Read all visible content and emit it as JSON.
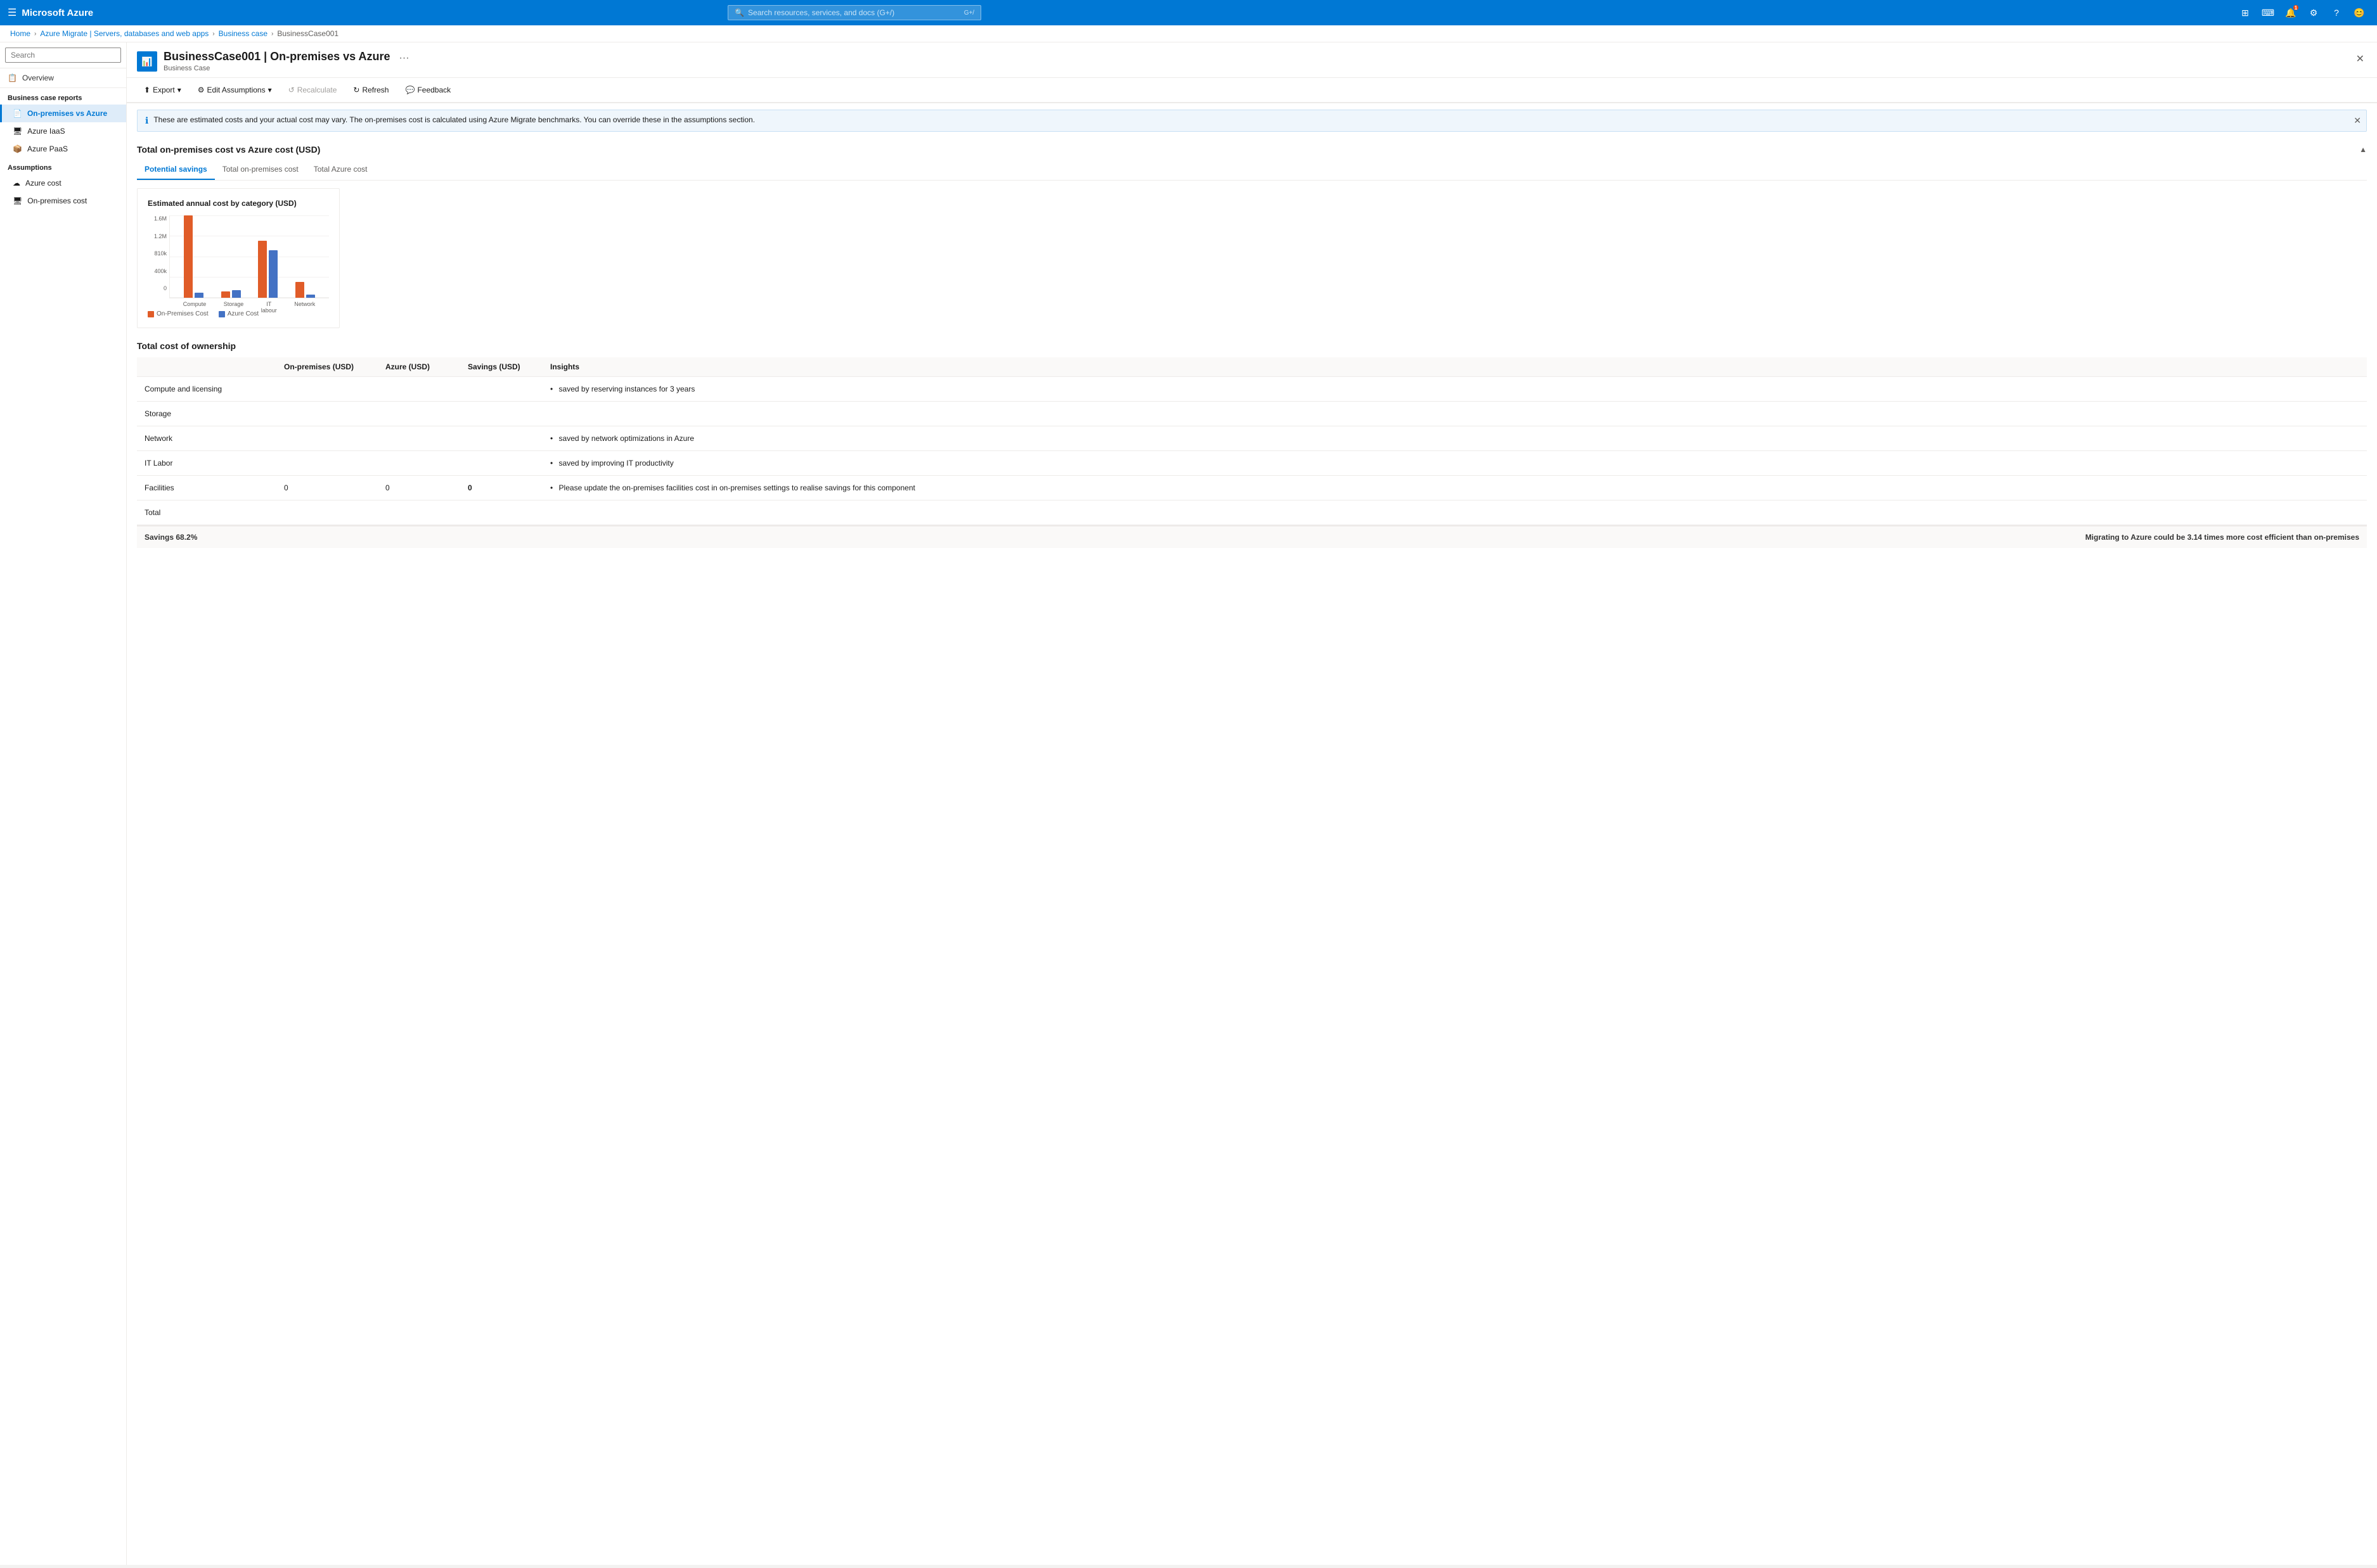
{
  "topnav": {
    "logo": "Microsoft Azure",
    "search_placeholder": "Search resources, services, and docs (G+/)",
    "hamburger": "☰"
  },
  "breadcrumb": {
    "items": [
      "Home",
      "Azure Migrate | Servers, databases and web apps",
      "Business case",
      "BusinessCase001"
    ]
  },
  "page": {
    "title": "BusinessCase001 | On-premises vs Azure",
    "subtitle": "Business Case",
    "icon": "📊"
  },
  "toolbar": {
    "export_label": "Export",
    "edit_assumptions_label": "Edit Assumptions",
    "recalculate_label": "Recalculate",
    "refresh_label": "Refresh",
    "feedback_label": "Feedback"
  },
  "info_banner": {
    "text": "These are estimated costs and your actual cost may vary. The on-premises cost is calculated using Azure Migrate benchmarks. You can override these in the assumptions section."
  },
  "sidebar": {
    "search_placeholder": "Search",
    "overview_label": "Overview",
    "reports_section_label": "Business case reports",
    "reports": [
      {
        "label": "On-premises vs Azure",
        "active": true,
        "icon": "📄"
      },
      {
        "label": "Azure IaaS",
        "active": false,
        "icon": "🖥"
      },
      {
        "label": "Azure PaaS",
        "active": false,
        "icon": "📦"
      }
    ],
    "assumptions_section_label": "Assumptions",
    "assumptions": [
      {
        "label": "Azure cost",
        "active": false,
        "icon": "☁"
      },
      {
        "label": "On-premises cost",
        "active": false,
        "icon": "🖧"
      }
    ]
  },
  "main": {
    "section_title": "Total on-premises cost vs Azure cost (USD)",
    "tabs": [
      {
        "label": "Potential savings",
        "active": true
      },
      {
        "label": "Total on-premises cost",
        "active": false
      },
      {
        "label": "Total Azure cost",
        "active": false
      }
    ],
    "chart": {
      "title": "Estimated annual cost by category (USD)",
      "y_labels": [
        "1.6M",
        "1.2M",
        "810k",
        "400k",
        "0"
      ],
      "x_labels": [
        "Compute",
        "Storage",
        "IT labour",
        "Network"
      ],
      "bars": [
        {
          "category": "Compute",
          "on_premises": 100,
          "azure": 5
        },
        {
          "category": "Storage",
          "on_premises": 10,
          "azure": 12
        },
        {
          "category": "IT labour",
          "on_premises": 72,
          "azure": 62
        },
        {
          "category": "Network",
          "on_premises": 20,
          "azure": 5
        }
      ],
      "legend": {
        "on_premises": "On-Premises Cost",
        "azure": "Azure Cost"
      }
    },
    "tco": {
      "title": "Total cost of ownership",
      "headers": [
        "",
        "On-premises (USD)",
        "Azure (USD)",
        "Savings (USD)",
        "Insights"
      ],
      "rows": [
        {
          "label": "Compute and licensing",
          "on_premises": "",
          "azure": "",
          "savings": "",
          "insight": "saved by reserving instances for 3 years"
        },
        {
          "label": "Storage",
          "on_premises": "",
          "azure": "",
          "savings": "",
          "insight": ""
        },
        {
          "label": "Network",
          "on_premises": "",
          "azure": "",
          "savings": "",
          "insight": "saved by network optimizations in Azure"
        },
        {
          "label": "IT Labor",
          "on_premises": "",
          "azure": "",
          "savings": "",
          "insight": "saved by improving IT productivity"
        },
        {
          "label": "Facilities",
          "on_premises": "0",
          "azure": "0",
          "savings": "0",
          "insight": "Please update the on-premises facilities cost in on-premises settings to realise savings for this component"
        },
        {
          "label": "Total",
          "on_premises": "",
          "azure": "",
          "savings": "",
          "insight": ""
        }
      ],
      "footer": {
        "savings_pct": "Savings 68.2%",
        "savings_msg": "Migrating to Azure could be 3.14 times more cost efficient than on-premises"
      }
    }
  }
}
